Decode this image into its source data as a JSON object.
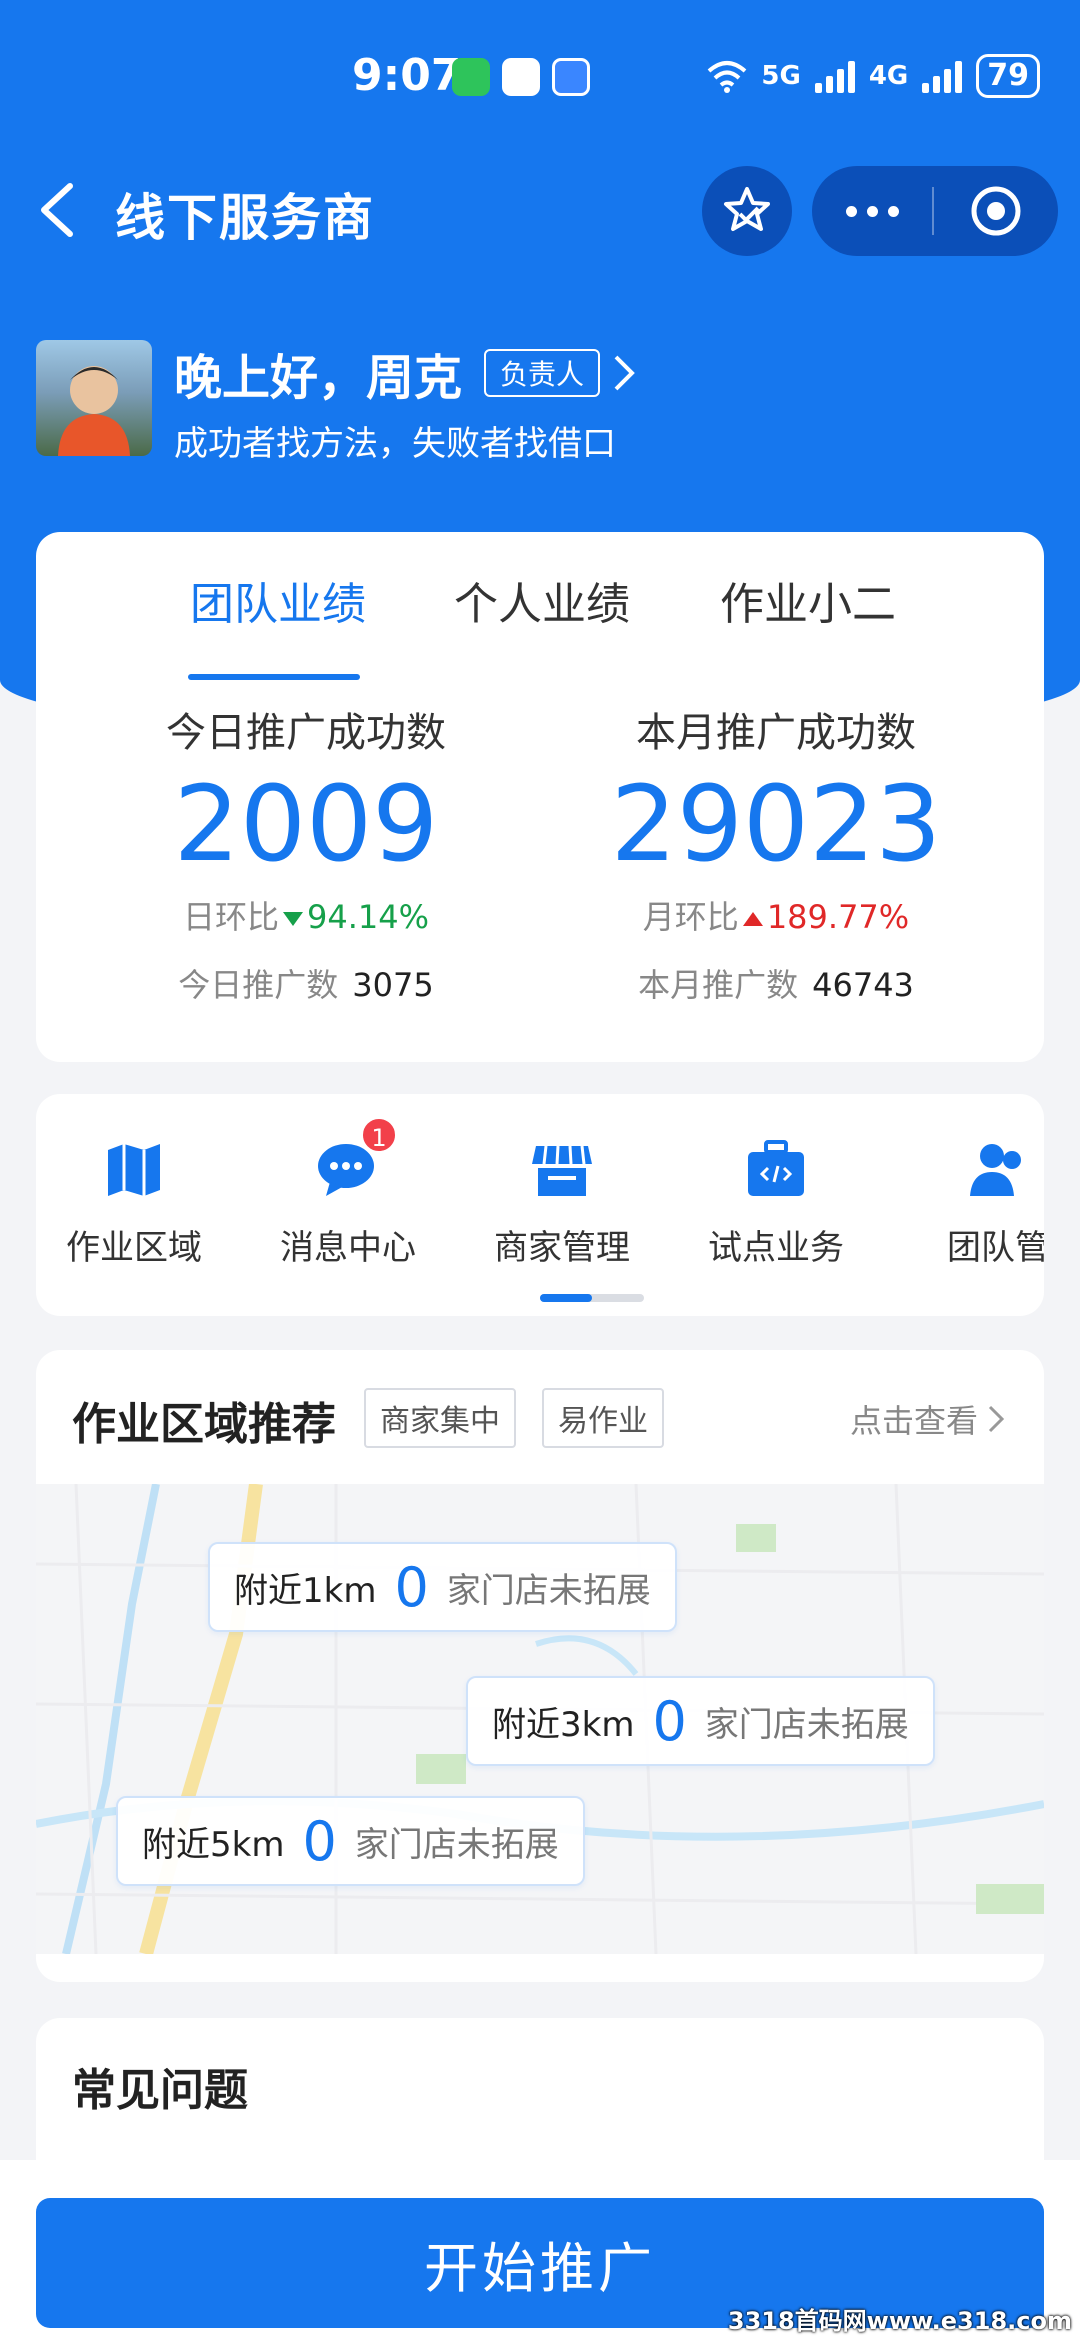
{
  "status_bar": {
    "time": "9:07",
    "net1": "5G",
    "net2": "4G",
    "battery": "79"
  },
  "nav": {
    "title": "线下服务商"
  },
  "user": {
    "greeting": "晚上好，周克",
    "role": "负责人",
    "motto": "成功者找方法，失败者找借口"
  },
  "stats": {
    "tabs": [
      {
        "label": "团队业绩",
        "active": true
      },
      {
        "label": "个人业绩",
        "active": false
      },
      {
        "label": "作业小二",
        "active": false
      }
    ],
    "today": {
      "title": "今日推广成功数",
      "value": "2009",
      "ratio_label": "日环比",
      "ratio_value": "94.14%",
      "ratio_trend": "down",
      "total_label": "今日推广数",
      "total_value": "3075"
    },
    "month": {
      "title": "本月推广成功数",
      "value": "29023",
      "ratio_label": "月环比",
      "ratio_value": "189.77%",
      "ratio_trend": "up",
      "total_label": "本月推广数",
      "total_value": "46743"
    }
  },
  "menu": {
    "items": [
      {
        "label": "作业区域",
        "icon": "map-book-icon"
      },
      {
        "label": "消息中心",
        "icon": "chat-bubble-icon",
        "badge": "1"
      },
      {
        "label": "商家管理",
        "icon": "shop-icon"
      },
      {
        "label": "试点业务",
        "icon": "code-briefcase-icon"
      },
      {
        "label": "团队管",
        "icon": "team-icon"
      }
    ]
  },
  "area": {
    "title": "作业区域推荐",
    "tags": [
      "商家集中",
      "易作业"
    ],
    "more": "点击查看",
    "pills": [
      {
        "km": "附近1km",
        "count": "0",
        "desc": "家门店未拓展"
      },
      {
        "km": "附近3km",
        "count": "0",
        "desc": "家门店未拓展"
      },
      {
        "km": "附近5km",
        "count": "0",
        "desc": "家门店未拓展"
      }
    ]
  },
  "faq": {
    "title": "常见问题"
  },
  "cta": {
    "label": "开始推广"
  },
  "watermark": "3318首码网www.e318.com",
  "colors": {
    "primary": "#1677ee",
    "up": "#e02828",
    "down": "#16a04a"
  }
}
